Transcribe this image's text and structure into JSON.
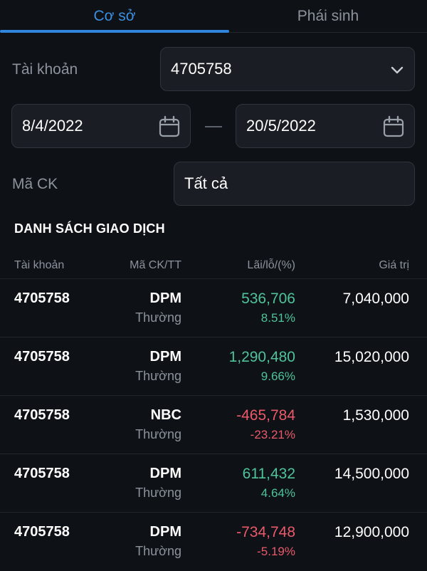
{
  "tabs": [
    {
      "label": "Cơ sở",
      "active": true
    },
    {
      "label": "Phái sinh",
      "active": false
    }
  ],
  "filters": {
    "account_label": "Tài khoản",
    "account_value": "4705758",
    "date_from": "8/4/2022",
    "date_to": "20/5/2022",
    "symbol_label": "Mã CK",
    "symbol_value": "Tất cả"
  },
  "section_title": "DANH SÁCH GIAO DỊCH",
  "table": {
    "headers": [
      "Tài khoản",
      "Mã CK/TT",
      "Lãi/lỗ/(%)",
      "Giá trị"
    ],
    "rows": [
      {
        "account": "4705758",
        "symbol": "DPM",
        "type": "Thường",
        "pl": "536,706",
        "pct": "8.51%",
        "value": "7,040,000",
        "trend": "pos"
      },
      {
        "account": "4705758",
        "symbol": "DPM",
        "type": "Thường",
        "pl": "1,290,480",
        "pct": "9.66%",
        "value": "15,020,000",
        "trend": "pos"
      },
      {
        "account": "4705758",
        "symbol": "NBC",
        "type": "Thường",
        "pl": "-465,784",
        "pct": "-23.21%",
        "value": "1,530,000",
        "trend": "neg"
      },
      {
        "account": "4705758",
        "symbol": "DPM",
        "type": "Thường",
        "pl": "611,432",
        "pct": "4.64%",
        "value": "14,500,000",
        "trend": "pos"
      },
      {
        "account": "4705758",
        "symbol": "DPM",
        "type": "Thường",
        "pl": "-734,748",
        "pct": "-5.19%",
        "value": "12,900,000",
        "trend": "neg"
      }
    ]
  },
  "colors": {
    "accent": "#2f86dc",
    "positive": "#4fc39a",
    "negative": "#ea5a6a",
    "background": "#0e1116"
  },
  "icons": {
    "dropdown": "chevron-down-icon",
    "calendar": "calendar-icon"
  }
}
